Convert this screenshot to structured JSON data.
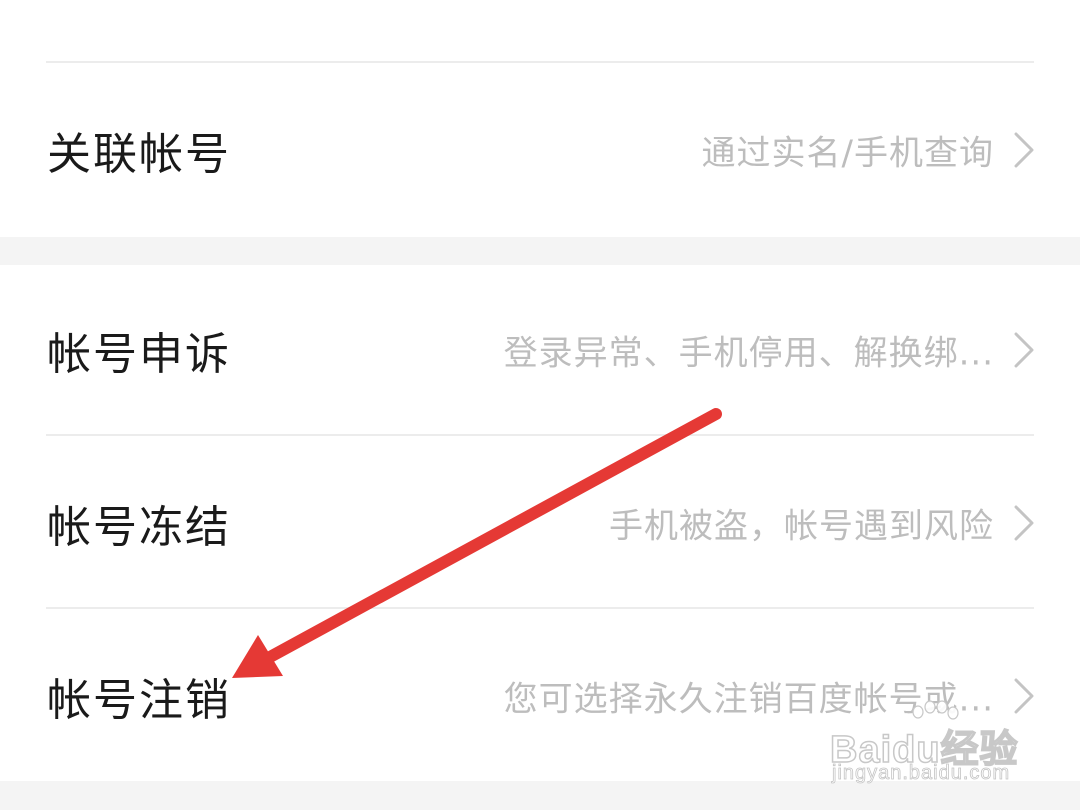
{
  "rows": [
    {
      "label": "关联帐号",
      "description": "通过实名/手机查询"
    },
    {
      "label": "帐号申诉",
      "description": "登录异常、手机停用、解换绑..."
    },
    {
      "label": "帐号冻结",
      "description": "手机被盗，帐号遇到风险"
    },
    {
      "label": "帐号注销",
      "description": "您可选择永久注销百度帐号或..."
    }
  ],
  "annotation": {
    "arrow_color": "#e53935"
  },
  "watermark": {
    "brand": "Baidu经验",
    "url": "jingyan.baidu.com"
  },
  "icons": {
    "row_chevron": "chevron-right-icon"
  }
}
